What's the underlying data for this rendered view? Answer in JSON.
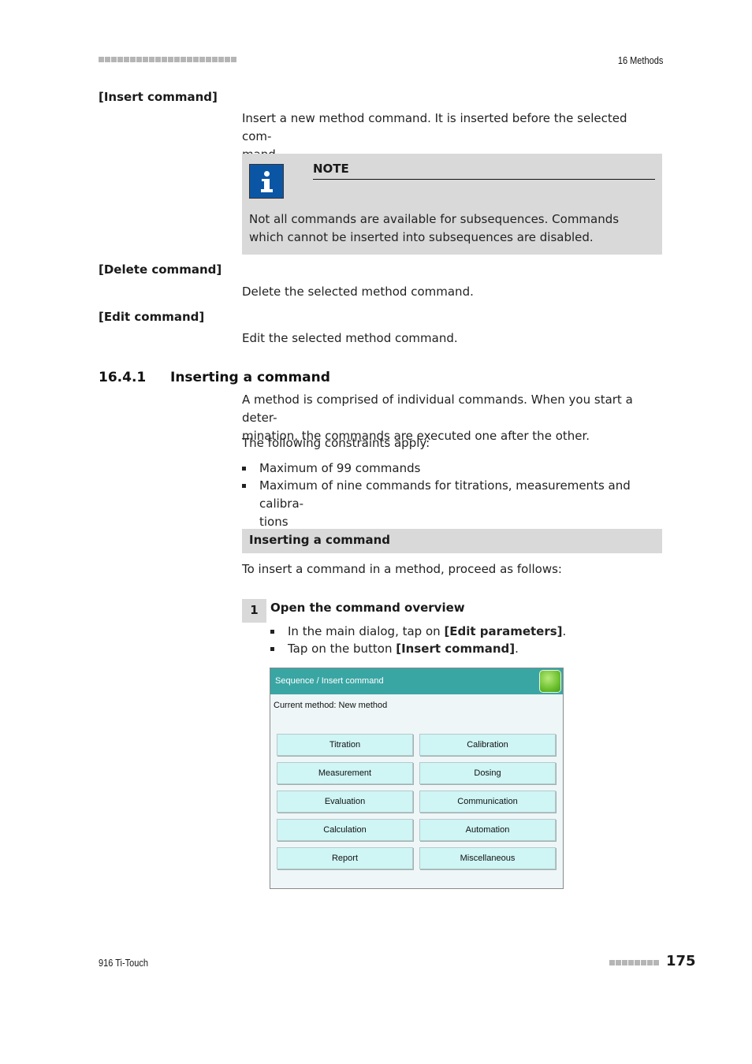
{
  "header": {
    "chapter": "16 Methods",
    "squares_count": 22
  },
  "entries": [
    {
      "term": "[Insert command]",
      "description": "Insert a new method command. It is inserted before the selected com-mand."
    },
    {
      "term": "[Delete command]",
      "description": "Delete the selected method command."
    },
    {
      "term": "[Edit command]",
      "description": "Edit the selected method command."
    }
  ],
  "note": {
    "icon": "info-icon",
    "title": "NOTE",
    "text": "Not all commands are available for subsequences. Commands which cannot be inserted into subsequences are disabled."
  },
  "section": {
    "number": "16.4.1",
    "title": "Inserting a command",
    "intro": "A method is comprised of individual commands. When you start a deter-mination, the commands are executed one after the other.",
    "constraints_label": "The following constraints apply:",
    "constraints": [
      "Maximum of 99 commands",
      "Maximum of nine commands for titrations, measurements and calibra-tions"
    ]
  },
  "procedure": {
    "title": "Inserting a command",
    "intro": "To insert a command in a method, proceed as follows:",
    "steps": [
      {
        "number": "1",
        "title": "Open the command overview",
        "bullets": [
          {
            "pre": "In the main dialog, tap on ",
            "bold": "[Edit parameters]",
            "post": "."
          },
          {
            "pre": "Tap on the button ",
            "bold": "[Insert command]",
            "post": "."
          }
        ]
      }
    ]
  },
  "screenshot": {
    "title": "Sequence / Insert command",
    "home_icon": "home-button-icon",
    "subtitle": "Current method: New method",
    "buttons": [
      "Titration",
      "Calibration",
      "Measurement",
      "Dosing",
      "Evaluation",
      "Communication",
      "Calculation",
      "Automation",
      "Report",
      "Miscellaneous"
    ]
  },
  "footer": {
    "product": "916 Ti-Touch",
    "page": "175",
    "squares_count": 8
  }
}
